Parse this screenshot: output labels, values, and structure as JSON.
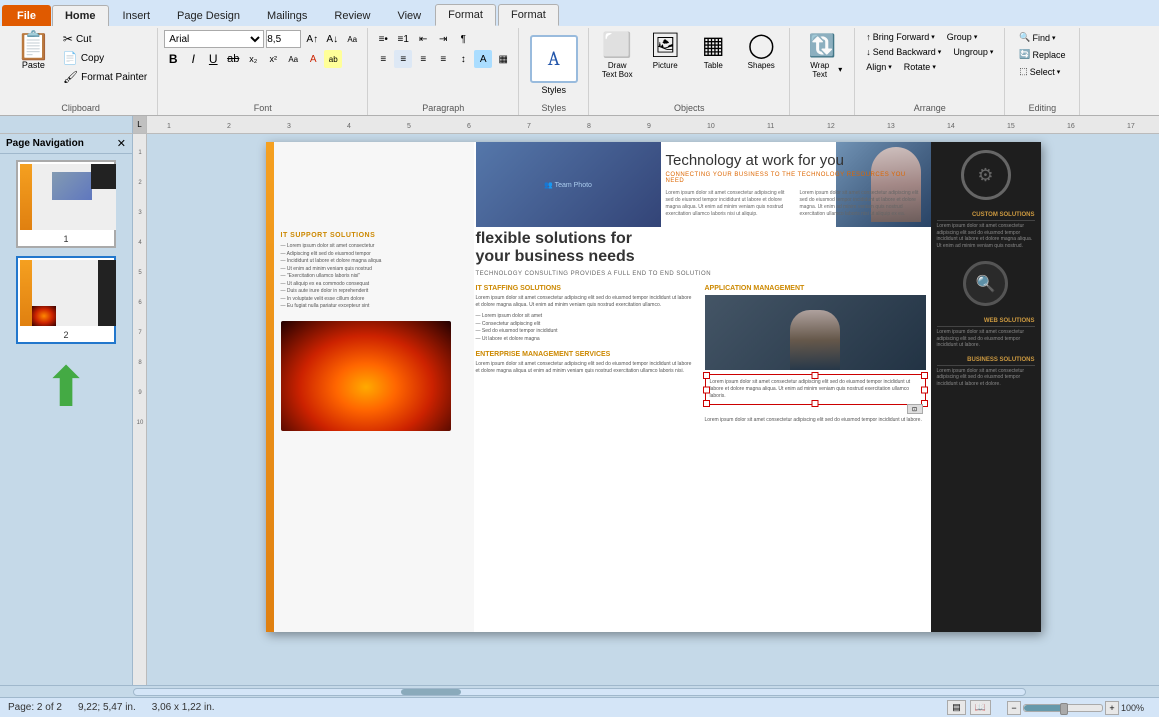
{
  "tabs": {
    "file": "File",
    "home": "Home",
    "insert": "Insert",
    "page_design": "Page Design",
    "mailings": "Mailings",
    "review": "Review",
    "view": "View",
    "format1": "Format",
    "format2": "Format"
  },
  "clipboard": {
    "label": "Clipboard",
    "paste": "Paste",
    "cut": "Cut",
    "copy": "Copy",
    "format_painter": "Format Painter"
  },
  "font": {
    "label": "Font",
    "name": "Arial",
    "size": "8,5",
    "bold": "B",
    "italic": "I",
    "underline": "U",
    "strikethrough": "ab"
  },
  "paragraph": {
    "label": "Paragraph"
  },
  "styles": {
    "label": "Styles",
    "sample": "A"
  },
  "objects": {
    "label": "Objects",
    "draw_text_box": "Draw\nText Box",
    "picture": "Picture",
    "table": "Table",
    "shapes": "Shapes"
  },
  "wrap": {
    "label": "Wrap\nText",
    "arrow": "▾"
  },
  "arrange": {
    "label": "Arrange",
    "bring_forward": "Bring Forward",
    "send_backward": "Send Backward",
    "align": "Align",
    "group": "Group",
    "ungroup": "Ungroup",
    "rotate": "Rotate"
  },
  "editing": {
    "label": "Editing",
    "find": "Find",
    "replace": "Replace",
    "select": "Select"
  },
  "nav": {
    "title": "Page Navigation",
    "close": "✕",
    "pages": [
      "1",
      "2"
    ]
  },
  "status": {
    "page": "Page: 2 of 2",
    "position": "9,22; 5,47 in.",
    "size": "3,06 x 1,22 in.",
    "zoom_label": "100%"
  },
  "document": {
    "title": "Technology at work for you",
    "subtitle": "CONNECTING YOUR BUSINESS TO THE TECHNOLOGY RESOURCES YOU NEED",
    "flex_title": "flexible solutions for",
    "flex_subtitle": "your business needs",
    "it_support": "IT SUPPORT SOLUTIONS",
    "it_staffing": "IT STAFFING SOLUTIONS",
    "app_mgmt": "APPLICATION MANAGEMENT",
    "enterprise": "ENTERPRISE MANAGEMENT SERVICES",
    "tech_consulting": "TECHNOLOGY CONSULTING PROVIDES A FULL END TO END SOLUTION",
    "custom_solutions": "CUSTOM SOLUTIONS",
    "web_solutions": "WEB SOLUTIONS",
    "business_solutions": "BUSINESS SOLUTIONS"
  }
}
